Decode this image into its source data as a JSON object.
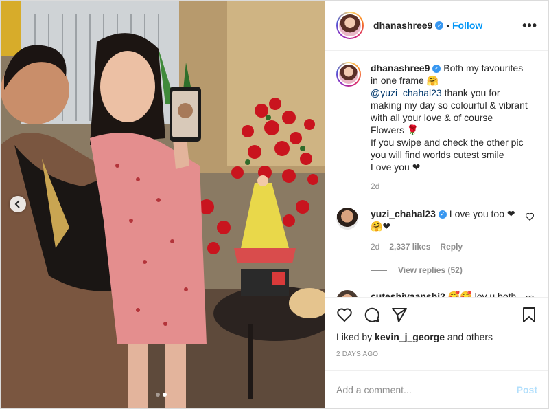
{
  "header": {
    "username": "dhanashree9",
    "verified": true,
    "separator": "•",
    "follow_label": "Follow",
    "more_label": "•••"
  },
  "caption": {
    "username": "dhanashree9",
    "line1": "Both my favourites in one frame 🤗",
    "mention": "@yuzi_chahal23",
    "line2": " thank you for making my day so colourful & vibrant with all your love & of course Flowers 🌹",
    "line3": "If you swipe and check the other pic you will find worlds cutest smile",
    "line4": "Love you ❤",
    "time": "2d"
  },
  "comments": [
    {
      "username": "yuzi_chahal23",
      "verified": true,
      "text": "Love you too ❤ 🤗❤",
      "time": "2d",
      "likes": "2,337 likes",
      "reply_label": "Reply",
      "view_replies": "View replies (52)"
    },
    {
      "username": "cuteshivaanshi2",
      "verified": false,
      "text": "🥰🥰 lov u both mamu and dhanna mami🥰🥰"
    }
  ],
  "likes": {
    "prefix": "Liked by ",
    "user": "kevin_j_george",
    "suffix": " and others"
  },
  "date": "2 days ago",
  "add_comment": {
    "placeholder": "Add a comment...",
    "post_label": "Post"
  },
  "carousel": {
    "current": 1,
    "total": 2,
    "prev_icon": "chevron-left-icon"
  },
  "colors": {
    "link": "#0095f6",
    "mention": "#00376b",
    "muted": "#8e8e8e",
    "post_disabled": "#b2dffc",
    "verified": "#3897f0"
  }
}
